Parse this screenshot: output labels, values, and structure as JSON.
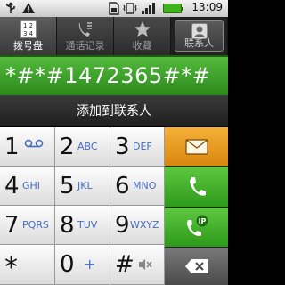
{
  "status_bar": {
    "time": "13:09"
  },
  "tabs": [
    {
      "label": "拨号盘",
      "active": true
    },
    {
      "label": "通话记录",
      "active": false
    },
    {
      "label": "收藏",
      "active": false
    },
    {
      "label": "联系人",
      "active": false
    }
  ],
  "dialer": {
    "digits": "*#*#1472365#*#",
    "add_to_contacts": "添加到联系人"
  },
  "keys": [
    {
      "num": "1",
      "letters": ""
    },
    {
      "num": "2",
      "letters": "ABC"
    },
    {
      "num": "3",
      "letters": "DEF"
    },
    {
      "num": "4",
      "letters": "GHI"
    },
    {
      "num": "5",
      "letters": "JKL"
    },
    {
      "num": "6",
      "letters": "MNO"
    },
    {
      "num": "7",
      "letters": "PQRS"
    },
    {
      "num": "8",
      "letters": "TUV"
    },
    {
      "num": "9",
      "letters": "WXYZ"
    },
    {
      "num": "*",
      "letters": ""
    },
    {
      "num": "0",
      "letters": "+"
    },
    {
      "num": "#",
      "letters": ""
    }
  ],
  "ip_badge": "IP",
  "colors": {
    "green": "#3aa526",
    "orange": "#e89a1f"
  }
}
